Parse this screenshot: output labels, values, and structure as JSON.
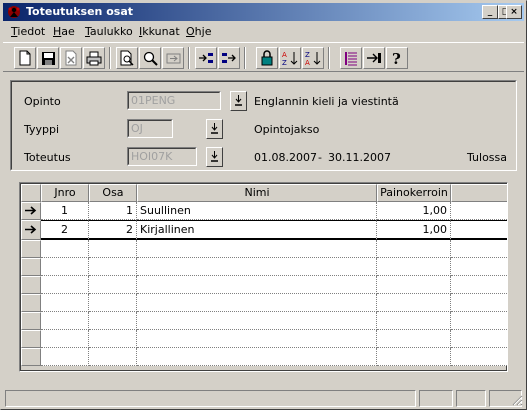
{
  "window": {
    "title": "Toteutuksen osat",
    "buttons": {
      "minimize": "_",
      "maximize": "□",
      "close": "×"
    }
  },
  "menu": [
    {
      "mnemonic": "T",
      "rest": "iedot"
    },
    {
      "mnemonic": "H",
      "rest": "ae"
    },
    {
      "mnemonic": "T",
      "rest": "aulukko"
    },
    {
      "mnemonic": "I",
      "rest": "kkunat"
    },
    {
      "mnemonic": "O",
      "rest": "hje"
    }
  ],
  "toolbar_icons": [
    "new-document-icon",
    "save-icon",
    "delete-icon",
    "print-icon",
    "print-preview-icon",
    "find-icon",
    "goto-icon",
    "insert-row-icon",
    "append-row-icon",
    "lock-icon",
    "sort-ascending-icon",
    "sort-descending-icon",
    "list-icon",
    "exit-icon",
    "help-icon"
  ],
  "form": {
    "opinto": {
      "label": "Opinto",
      "value": "01PENG",
      "description": "Englannin kieli ja viestintä"
    },
    "tyyppi": {
      "label": "Tyyppi",
      "value": "OJ",
      "description": "Opintojakso"
    },
    "toteutus": {
      "label": "Toteutus",
      "value": "HOI07K",
      "start": "01.08.2007",
      "separator": "-",
      "end": "30.11.2007",
      "status": "Tulossa"
    }
  },
  "grid": {
    "columns": [
      "Jnro",
      "Osa",
      "Nimi",
      "Painokerroin"
    ],
    "rows": [
      {
        "jnro": "1",
        "osa": "1",
        "nimi": "Suullinen",
        "painokerroin": "1,00"
      },
      {
        "jnro": "2",
        "osa": "2",
        "nimi": "Kirjallinen",
        "painokerroin": "1,00"
      }
    ]
  },
  "colors": {
    "title_start": "#0a246a",
    "title_end": "#a6caf0",
    "face": "#d4d0c8",
    "disabled_text": "#a0a0a0"
  }
}
